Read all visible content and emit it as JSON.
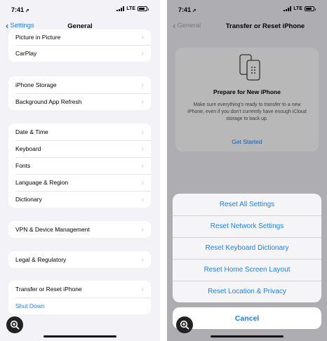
{
  "left": {
    "status": {
      "time": "7:41",
      "carrier": "LTE"
    },
    "nav": {
      "back_label": "Settings",
      "title": "General"
    },
    "groups": [
      [
        "Picture in Picture",
        "CarPlay"
      ],
      [
        "iPhone Storage",
        "Background App Refresh"
      ],
      [
        "Date & Time",
        "Keyboard",
        "Fonts",
        "Language & Region",
        "Dictionary"
      ],
      [
        "VPN & Device Management"
      ],
      [
        "Legal & Regulatory"
      ],
      [
        "Transfer or Reset iPhone",
        "Shut Down"
      ]
    ],
    "zoom_icon": "magnifier-plus-icon"
  },
  "right": {
    "status": {
      "time": "7:41",
      "carrier": "LTE"
    },
    "nav": {
      "back_label": "General",
      "title": "Transfer or Reset iPhone"
    },
    "card": {
      "icon": "phones-transfer-icon",
      "title": "Prepare for New iPhone",
      "description": "Make sure everything's ready to transfer to a new iPhone, even if you don't currently have enough iCloud storage to back up.",
      "link": "Get Started"
    },
    "sheet": {
      "options": [
        "Reset All Settings",
        "Reset Network Settings",
        "Reset Keyboard Dictionary",
        "Reset Home Screen Layout",
        "Reset Location & Privacy"
      ],
      "cancel": "Cancel"
    },
    "zoom_icon": "magnifier-plus-icon"
  },
  "colors": {
    "accent": "#1a7ff5",
    "background": "#f2f2f7"
  }
}
